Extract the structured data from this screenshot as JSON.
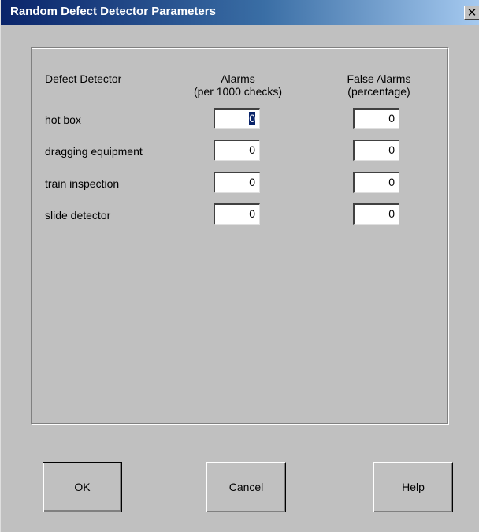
{
  "window": {
    "title": "Random Defect Detector Parameters",
    "close_glyph": "✕"
  },
  "columns": {
    "detector_header": "Defect Detector",
    "alarms_header_line1": "Alarms",
    "alarms_header_line2": "(per 1000 checks)",
    "false_header_line1": "False Alarms",
    "false_header_line2": "(percentage)"
  },
  "rows": [
    {
      "label": "hot box",
      "alarms": "0",
      "false_alarms": "0"
    },
    {
      "label": "dragging equipment",
      "alarms": "0",
      "false_alarms": "0"
    },
    {
      "label": "train inspection",
      "alarms": "0",
      "false_alarms": "0"
    },
    {
      "label": "slide detector",
      "alarms": "0",
      "false_alarms": "0"
    }
  ],
  "buttons": {
    "ok": "OK",
    "cancel": "Cancel",
    "help": "Help"
  },
  "colors": {
    "title_bar_start": "#0a246a",
    "title_bar_end": "#a6caf0",
    "face": "#c0c0c0",
    "selection": "#0a246a"
  }
}
